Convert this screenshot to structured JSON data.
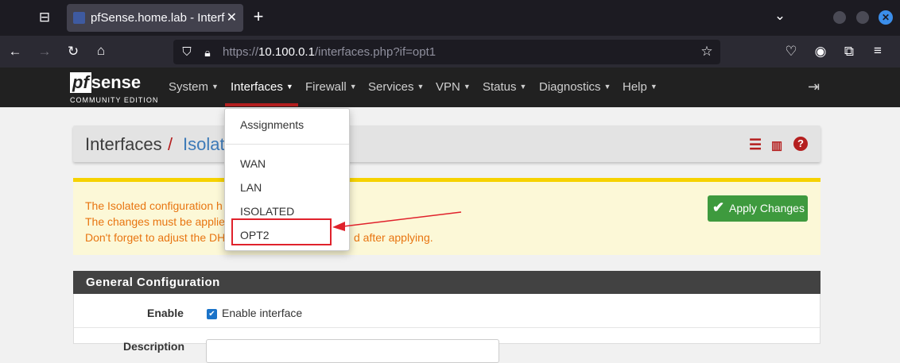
{
  "browser": {
    "tab_title": "pfSense.home.lab - Interf",
    "tab_close": "✕",
    "new_tab": "+",
    "url_prefix": "https://",
    "url_host": "10.100.0.1",
    "url_path": "/interfaces.php?if=opt1"
  },
  "logo": {
    "pf": "pf",
    "sense": "sense",
    "edition": "COMMUNITY EDITION"
  },
  "nav": {
    "items": [
      "System",
      "Interfaces",
      "Firewall",
      "Services",
      "VPN",
      "Status",
      "Diagnostics",
      "Help"
    ],
    "active": "Interfaces"
  },
  "breadcrumb": {
    "section": "Interfaces",
    "separator": "/",
    "page": "Isolat"
  },
  "alert": {
    "line1": "The Isolated configuration h",
    "line2": "The changes must be applie",
    "line3_start": "Don't forget to adjust the DH",
    "line3_end": "d after applying.",
    "apply_button": "Apply Changes"
  },
  "panel": {
    "title": "General Configuration",
    "enable_label": "Enable",
    "enable_checkbox_text": "Enable interface",
    "enable_checked": true,
    "description_label": "Description"
  },
  "dropdown": {
    "assignments": "Assignments",
    "items": [
      "WAN",
      "LAN",
      "ISOLATED",
      "OPT2"
    ],
    "highlighted": "OPT2"
  },
  "colors": {
    "accent_red": "#b51f1f",
    "annotation_red": "#e0222c",
    "alert_text": "#e87511",
    "apply_green": "#3e9a3e"
  }
}
